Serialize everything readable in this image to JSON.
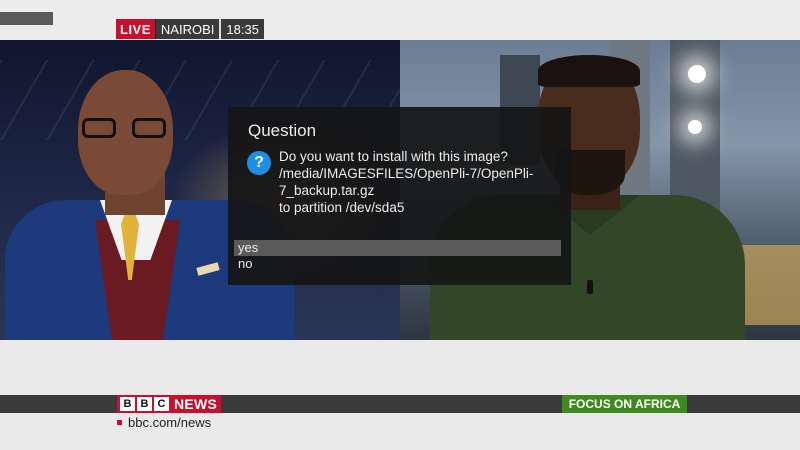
{
  "broadcast": {
    "live_label": "LIVE",
    "location": "NAIROBI",
    "time": "18:35"
  },
  "dialog": {
    "title": "Question",
    "icon": "question-icon",
    "message_lines": [
      "Do you want to install with this image?",
      "/media/IMAGESFILES/OpenPli-7/OpenPli-",
      "7_backup.tar.gz",
      "to partition /dev/sda5"
    ],
    "options": [
      "yes",
      "no"
    ],
    "selected_option": "yes"
  },
  "branding": {
    "logo_letters": [
      "B",
      "B",
      "C"
    ],
    "logo_word": "NEWS",
    "programme": "FOCUS ON AFRICA",
    "website": "bbc.com/news"
  },
  "colors": {
    "bbc_red": "#c8102e",
    "programme_green": "#3f8a1f",
    "dialog_bg": "#161616",
    "selection_bg": "#5a5a5a",
    "question_icon_blue": "#1d8fe6"
  }
}
